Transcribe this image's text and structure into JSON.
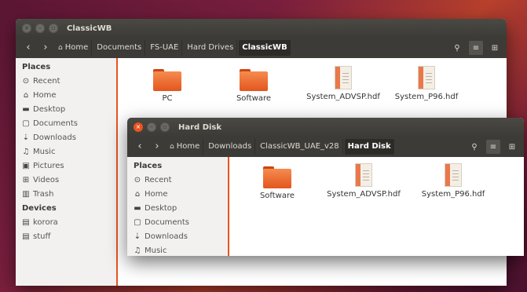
{
  "window1": {
    "title": "ClassicWB",
    "breadcrumbs": [
      "Home",
      "Documents",
      "FS-UAE",
      "Hard Drives",
      "ClassicWB"
    ],
    "sidebar": {
      "places_header": "Places",
      "places": [
        {
          "label": "Recent",
          "icon": "⊙"
        },
        {
          "label": "Home",
          "icon": "⌂"
        },
        {
          "label": "Desktop",
          "icon": "▬"
        },
        {
          "label": "Documents",
          "icon": "▢"
        },
        {
          "label": "Downloads",
          "icon": "⇣"
        },
        {
          "label": "Music",
          "icon": "♫"
        },
        {
          "label": "Pictures",
          "icon": "▣"
        },
        {
          "label": "Videos",
          "icon": "⊞"
        },
        {
          "label": "Trash",
          "icon": "▥"
        }
      ],
      "devices_header": "Devices",
      "devices": [
        {
          "label": "korora",
          "icon": "▤"
        },
        {
          "label": "stuff",
          "icon": "▤"
        }
      ]
    },
    "files": [
      {
        "name": "PC",
        "type": "folder"
      },
      {
        "name": "Software",
        "type": "folder"
      },
      {
        "name": "System_ADVSP.hdf",
        "type": "document"
      },
      {
        "name": "System_P96.hdf",
        "type": "document"
      }
    ]
  },
  "window2": {
    "title": "Hard Disk",
    "breadcrumbs": [
      "Home",
      "Downloads",
      "ClassicWB_UAE_v28",
      "Hard Disk"
    ],
    "sidebar": {
      "places_header": "Places",
      "places": [
        {
          "label": "Recent",
          "icon": "⊙"
        },
        {
          "label": "Home",
          "icon": "⌂"
        },
        {
          "label": "Desktop",
          "icon": "▬"
        },
        {
          "label": "Documents",
          "icon": "▢"
        },
        {
          "label": "Downloads",
          "icon": "⇣"
        },
        {
          "label": "Music",
          "icon": "♫"
        }
      ]
    },
    "files": [
      {
        "name": "Software",
        "type": "folder"
      },
      {
        "name": "System_ADVSP.hdf",
        "type": "document"
      },
      {
        "name": "System_P96.hdf",
        "type": "document"
      }
    ]
  },
  "icons": {
    "back": "‹",
    "forward": "›",
    "search": "⚲",
    "list": "≡",
    "grid": "⊞",
    "close": "×",
    "minimize": "–",
    "maximize": "▫"
  },
  "colors": {
    "accent": "#e95420",
    "titlebar": "#3c3b37"
  }
}
